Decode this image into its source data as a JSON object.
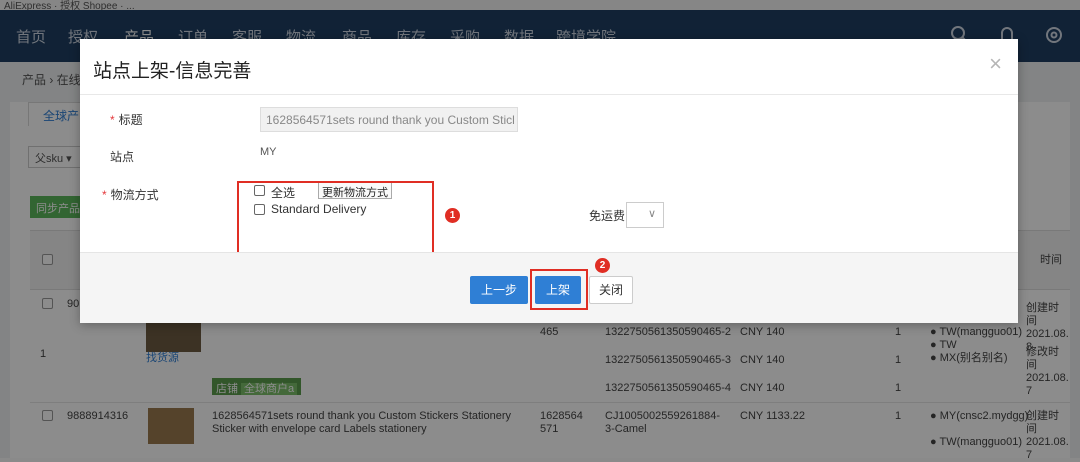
{
  "top_strip": {
    "text": "AliExpress · 授权 Shopee · ..."
  },
  "nav": {
    "items": [
      "首页",
      "授权",
      "产品",
      "订单",
      "客服",
      "物流",
      "商品",
      "库存",
      "采购",
      "数据",
      "跨境学院"
    ],
    "active_index": 2
  },
  "breadcrumb": "产品 › 在线",
  "background": {
    "tab_global": "全球产品",
    "sku_filter": "父sku ▾",
    "sync_button": "同步产品",
    "col_time": "时间",
    "rows": [
      {
        "id": "90",
        "idx": "1",
        "find_source": "找货源",
        "num": "465",
        "skus": [
          "1322750561350590465-2",
          "1322750561350590465-3",
          "1322750561350590465-4"
        ],
        "price": "CNY 140",
        "qty": "1",
        "stores": [
          "TW(mangguo01)",
          "TW",
          "MX(别名别名)"
        ],
        "created": "创建时间 2021.08. 8",
        "modified": "修改时间 2021.08. 7"
      },
      {
        "id": "9888914316",
        "title": "1628564571sets round thank you Custom Stickers Stationery Sticker with envelope card Labels stationery",
        "num": "1628564571",
        "sku": "CJ1005002559261884-3-Camel",
        "price": "CNY 1133.22",
        "qty": "1",
        "stores": [
          "MY(cnsc2.mydgg)",
          "TW(mangguo01)",
          "MX(别名别名)"
        ],
        "created": "创建时间 2021.08. 7"
      }
    ],
    "shop_tag": "店铺",
    "shop_tag_sub": "全球商户a"
  },
  "modal": {
    "title": "站点上架-信息完善",
    "close_symbol": "×",
    "fields": {
      "title_label": "标题",
      "title_value": "1628564571sets round thank you Custom Sticl",
      "site_label": "站点",
      "site_value": "MY",
      "shipping_label": "物流方式",
      "select_all": "全选",
      "update_shipping": "更新物流方式",
      "standard_delivery": "Standard Delivery",
      "free_shipping_label": "免运费：",
      "free_shipping_value": ""
    },
    "buttons": {
      "prev": "上一步",
      "list": "上架",
      "close": "关闭"
    },
    "annotations": [
      "1",
      "2"
    ]
  },
  "colors": {
    "nav_bg": "#1f3f63",
    "primary": "#2f7fd5",
    "annotation_red": "#e02e24",
    "green": "#5cb85c"
  }
}
